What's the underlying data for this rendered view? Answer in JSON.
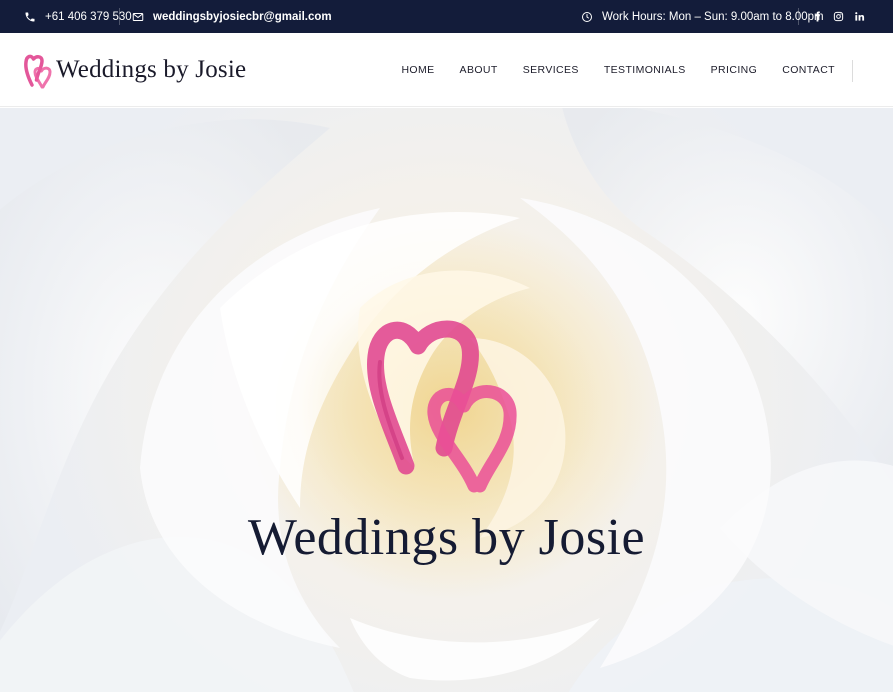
{
  "topbar": {
    "phone": "+61 406 379 530",
    "email": "weddingsbyjosiecbr@gmail.com",
    "hours": "Work Hours: Mon – Sun: 9.00am to 8.00pm",
    "icons": {
      "phone": "phone-icon",
      "email": "envelope-icon",
      "hours": "clock-icon",
      "social": [
        "facebook-icon",
        "instagram-icon",
        "linkedin-icon"
      ]
    }
  },
  "header": {
    "brand_name": "Weddings by Josie",
    "logo_icon": "double-heart-logo"
  },
  "nav": {
    "items": [
      "HOME",
      "ABOUT",
      "SERVICES",
      "TESTIMONIALS",
      "PRICING",
      "CONTACT"
    ]
  },
  "hero": {
    "title": "Weddings by Josie",
    "logo_icon": "double-heart-logo"
  },
  "colors": {
    "topbar_bg": "#131c3a",
    "heart_pink": "#e0458f",
    "title_navy": "#151b33",
    "rose_cream": "#f3dfa8"
  }
}
